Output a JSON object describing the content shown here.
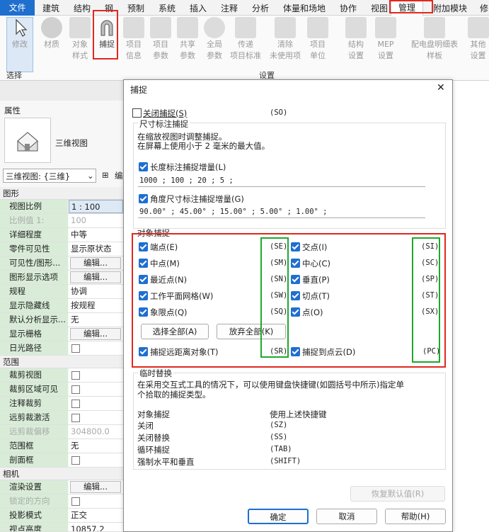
{
  "menu": {
    "file": "文件",
    "items": [
      "建筑",
      "结构",
      "钢",
      "预制",
      "系统",
      "插入",
      "注释",
      "分析",
      "体量和场地",
      "协作",
      "视图",
      "管理",
      "附加模块",
      "修"
    ]
  },
  "ribbon": {
    "buttons": [
      {
        "l1": "修改",
        "l2": ""
      },
      {
        "l1": "材质",
        "l2": ""
      },
      {
        "l1": "对象",
        "l2": "样式"
      },
      {
        "l1": "捕捉",
        "l2": ""
      },
      {
        "l1": "项目",
        "l2": "信息"
      },
      {
        "l1": "项目",
        "l2": "参数"
      },
      {
        "l1": "共享",
        "l2": "参数"
      },
      {
        "l1": "全局",
        "l2": "参数"
      },
      {
        "l1": "传递",
        "l2": "项目标准"
      },
      {
        "l1": "清除",
        "l2": "未使用项"
      },
      {
        "l1": "项目",
        "l2": "单位"
      },
      {
        "l1": "结构",
        "l2": "设置"
      },
      {
        "l1": "MEP",
        "l2": "设置"
      },
      {
        "l1": "配电盘明细表",
        "l2": "样板"
      },
      {
        "l1": "其他",
        "l2": "设置"
      }
    ],
    "group_select": "选择",
    "group_settings": "设置"
  },
  "properties": {
    "title": "属性",
    "type_name": "三维视图",
    "selector": "三维视图: {三维}",
    "edit_type": "编",
    "groups": {
      "graphics": "图形",
      "range": "范围",
      "camera": "相机"
    },
    "rows": {
      "r1": {
        "k": "视图比例",
        "v": "1 : 100"
      },
      "r2": {
        "k": "比例值 1:",
        "v": "100"
      },
      "r3": {
        "k": "详细程度",
        "v": "中等"
      },
      "r4": {
        "k": "零件可见性",
        "v": "显示原状态"
      },
      "r5": {
        "k": "可见性/图形...",
        "v": "编辑..."
      },
      "r6": {
        "k": "图形显示选项",
        "v": "编辑..."
      },
      "r7": {
        "k": "规程",
        "v": "协调"
      },
      "r8": {
        "k": "显示隐藏线",
        "v": "按规程"
      },
      "r9": {
        "k": "默认分析显示...",
        "v": "无"
      },
      "r10": {
        "k": "显示栅格",
        "v": "编辑..."
      },
      "r11": {
        "k": "日光路径",
        "v": ""
      },
      "r12": {
        "k": "裁剪视图",
        "v": ""
      },
      "r13": {
        "k": "裁剪区域可见",
        "v": ""
      },
      "r14": {
        "k": "注释裁剪",
        "v": ""
      },
      "r15": {
        "k": "远剪裁激活",
        "v": ""
      },
      "r16": {
        "k": "远剪裁偏移",
        "v": "304800.0"
      },
      "r17": {
        "k": "范围框",
        "v": "无"
      },
      "r18": {
        "k": "剖面框",
        "v": ""
      },
      "r19": {
        "k": "渲染设置",
        "v": "编辑..."
      },
      "r20": {
        "k": "锁定的方向",
        "v": ""
      },
      "r21": {
        "k": "投影模式",
        "v": "正交"
      },
      "r22": {
        "k": "视点高度",
        "v": "10857.2"
      }
    }
  },
  "dialog": {
    "title": "捕捉",
    "close": "✕",
    "snaps_off": {
      "label": "关闭捕捉(S)",
      "code": "(SO)"
    },
    "dim_section": "尺寸标注捕捉",
    "dim_desc1": "在缩放视图时调整捕捉。",
    "dim_desc2": "在屏幕上使用小于 2 毫米的最大值。",
    "length": {
      "label": "长度标注捕捉增量(L)",
      "value": "1000 ; 100 ; 20 ; 5 ;"
    },
    "angle": {
      "label": "角度尺寸标注捕捉增量(G)",
      "value": "90.00° ; 45.00° ; 15.00° ; 5.00° ; 1.00° ;"
    },
    "obj_section": "对象捕捉",
    "left_items": [
      {
        "label": "端点(E)",
        "code": "(SE)"
      },
      {
        "label": "中点(M)",
        "code": "(SM)"
      },
      {
        "label": "最近点(N)",
        "code": "(SN)"
      },
      {
        "label": "工作平面网格(W)",
        "code": "(SW)"
      },
      {
        "label": "象限点(Q)",
        "code": "(SQ)"
      }
    ],
    "right_items": [
      {
        "label": "交点(I)",
        "code": "(SI)"
      },
      {
        "label": "中心(C)",
        "code": "(SC)"
      },
      {
        "label": "垂直(P)",
        "code": "(SP)"
      },
      {
        "label": "切点(T)",
        "code": "(ST)"
      },
      {
        "label": "点(O)",
        "code": "(SX)"
      }
    ],
    "select_all": "选择全部(A)",
    "deselect_all": "放弃全部(K)",
    "remote": {
      "label": "捕捉远距离对象(T)",
      "code": "(SR)"
    },
    "cloud": {
      "label": "捕捉到点云(D)",
      "code": "(PC)"
    },
    "temp_section": "临时替换",
    "temp_desc1": "在采用交互式工具的情况下，可以使用键盘快捷键(如圆括号中所示)指定单",
    "temp_desc2": "个拾取的捕捉类型。",
    "overrides": [
      {
        "k": "对象捕捉",
        "v": "使用上述快捷键"
      },
      {
        "k": "关闭",
        "v": "(SZ)"
      },
      {
        "k": "关闭替换",
        "v": "(SS)"
      },
      {
        "k": "循环捕捉",
        "v": "(TAB)"
      },
      {
        "k": "强制水平和垂直",
        "v": "(SHIFT)"
      }
    ],
    "restore": "恢复默认值(R)",
    "ok": "确定",
    "cancel": "取消",
    "help": "帮助(H)"
  }
}
